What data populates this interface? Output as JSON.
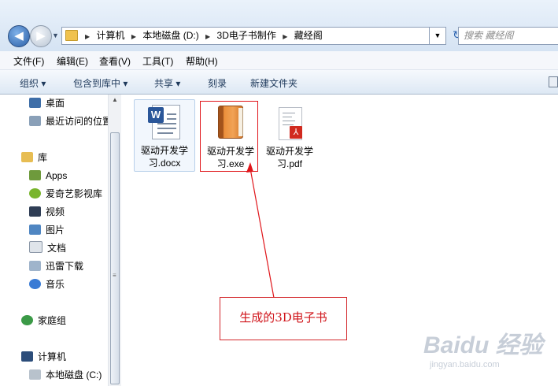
{
  "address_bar": {
    "crumbs": [
      "计算机",
      "本地磁盘 (D:)",
      "3D电子书制作",
      "藏经阁"
    ],
    "search_placeholder": "搜索 藏经阁"
  },
  "menu": [
    "文件(F)",
    "编辑(E)",
    "查看(V)",
    "工具(T)",
    "帮助(H)"
  ],
  "toolbar": {
    "organize": "组织 ▾",
    "include": "包含到库中 ▾",
    "share": "共享 ▾",
    "burn": "刻录",
    "new_folder": "新建文件夹"
  },
  "nav": {
    "desktop": "桌面",
    "recent": "最近访问的位置",
    "libraries": "库",
    "apps": "Apps",
    "iqiyi": "爱奇艺影视库",
    "videos": "视频",
    "pictures": "图片",
    "documents": "文档",
    "xunlei": "迅雷下载",
    "music": "音乐",
    "homegroup": "家庭组",
    "computer": "计算机",
    "local_disk": "本地磁盘 (C:)"
  },
  "files": [
    {
      "name": "驱动开发学习.docx",
      "line1": "驱动开发学",
      "line2": "习.docx",
      "icon": "word-document-icon"
    },
    {
      "name": "驱动开发学习.exe",
      "line1": "驱动开发学",
      "line2": "习.exe",
      "icon": "book-exe-icon"
    },
    {
      "name": "驱动开发学习.pdf",
      "line1": "驱动开发学",
      "line2": "习.pdf",
      "icon": "pdf-document-icon"
    }
  ],
  "annotation": {
    "callout_text": "生成的3D电子书",
    "color": "#e0151a"
  },
  "watermark": {
    "brand": "Baidu 经验",
    "url": "jingyan.baidu.com"
  }
}
